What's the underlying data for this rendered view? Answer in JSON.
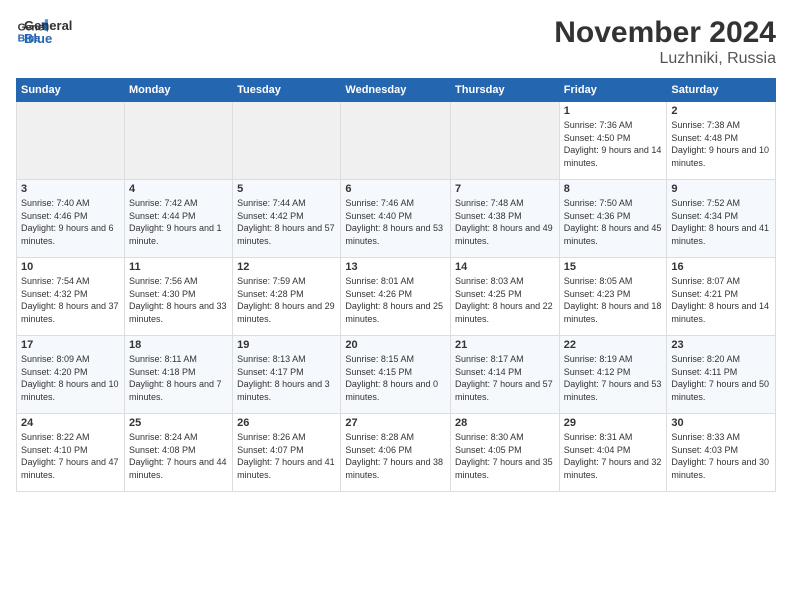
{
  "logo": {
    "line1": "General",
    "line2": "Blue"
  },
  "title": "November 2024",
  "subtitle": "Luzhniki, Russia",
  "days_of_week": [
    "Sunday",
    "Monday",
    "Tuesday",
    "Wednesday",
    "Thursday",
    "Friday",
    "Saturday"
  ],
  "rows": [
    [
      {
        "day": "",
        "info": ""
      },
      {
        "day": "",
        "info": ""
      },
      {
        "day": "",
        "info": ""
      },
      {
        "day": "",
        "info": ""
      },
      {
        "day": "",
        "info": ""
      },
      {
        "day": "1",
        "info": "Sunrise: 7:36 AM\nSunset: 4:50 PM\nDaylight: 9 hours and 14 minutes."
      },
      {
        "day": "2",
        "info": "Sunrise: 7:38 AM\nSunset: 4:48 PM\nDaylight: 9 hours and 10 minutes."
      }
    ],
    [
      {
        "day": "3",
        "info": "Sunrise: 7:40 AM\nSunset: 4:46 PM\nDaylight: 9 hours and 6 minutes."
      },
      {
        "day": "4",
        "info": "Sunrise: 7:42 AM\nSunset: 4:44 PM\nDaylight: 9 hours and 1 minute."
      },
      {
        "day": "5",
        "info": "Sunrise: 7:44 AM\nSunset: 4:42 PM\nDaylight: 8 hours and 57 minutes."
      },
      {
        "day": "6",
        "info": "Sunrise: 7:46 AM\nSunset: 4:40 PM\nDaylight: 8 hours and 53 minutes."
      },
      {
        "day": "7",
        "info": "Sunrise: 7:48 AM\nSunset: 4:38 PM\nDaylight: 8 hours and 49 minutes."
      },
      {
        "day": "8",
        "info": "Sunrise: 7:50 AM\nSunset: 4:36 PM\nDaylight: 8 hours and 45 minutes."
      },
      {
        "day": "9",
        "info": "Sunrise: 7:52 AM\nSunset: 4:34 PM\nDaylight: 8 hours and 41 minutes."
      }
    ],
    [
      {
        "day": "10",
        "info": "Sunrise: 7:54 AM\nSunset: 4:32 PM\nDaylight: 8 hours and 37 minutes."
      },
      {
        "day": "11",
        "info": "Sunrise: 7:56 AM\nSunset: 4:30 PM\nDaylight: 8 hours and 33 minutes."
      },
      {
        "day": "12",
        "info": "Sunrise: 7:59 AM\nSunset: 4:28 PM\nDaylight: 8 hours and 29 minutes."
      },
      {
        "day": "13",
        "info": "Sunrise: 8:01 AM\nSunset: 4:26 PM\nDaylight: 8 hours and 25 minutes."
      },
      {
        "day": "14",
        "info": "Sunrise: 8:03 AM\nSunset: 4:25 PM\nDaylight: 8 hours and 22 minutes."
      },
      {
        "day": "15",
        "info": "Sunrise: 8:05 AM\nSunset: 4:23 PM\nDaylight: 8 hours and 18 minutes."
      },
      {
        "day": "16",
        "info": "Sunrise: 8:07 AM\nSunset: 4:21 PM\nDaylight: 8 hours and 14 minutes."
      }
    ],
    [
      {
        "day": "17",
        "info": "Sunrise: 8:09 AM\nSunset: 4:20 PM\nDaylight: 8 hours and 10 minutes."
      },
      {
        "day": "18",
        "info": "Sunrise: 8:11 AM\nSunset: 4:18 PM\nDaylight: 8 hours and 7 minutes."
      },
      {
        "day": "19",
        "info": "Sunrise: 8:13 AM\nSunset: 4:17 PM\nDaylight: 8 hours and 3 minutes."
      },
      {
        "day": "20",
        "info": "Sunrise: 8:15 AM\nSunset: 4:15 PM\nDaylight: 8 hours and 0 minutes."
      },
      {
        "day": "21",
        "info": "Sunrise: 8:17 AM\nSunset: 4:14 PM\nDaylight: 7 hours and 57 minutes."
      },
      {
        "day": "22",
        "info": "Sunrise: 8:19 AM\nSunset: 4:12 PM\nDaylight: 7 hours and 53 minutes."
      },
      {
        "day": "23",
        "info": "Sunrise: 8:20 AM\nSunset: 4:11 PM\nDaylight: 7 hours and 50 minutes."
      }
    ],
    [
      {
        "day": "24",
        "info": "Sunrise: 8:22 AM\nSunset: 4:10 PM\nDaylight: 7 hours and 47 minutes."
      },
      {
        "day": "25",
        "info": "Sunrise: 8:24 AM\nSunset: 4:08 PM\nDaylight: 7 hours and 44 minutes."
      },
      {
        "day": "26",
        "info": "Sunrise: 8:26 AM\nSunset: 4:07 PM\nDaylight: 7 hours and 41 minutes."
      },
      {
        "day": "27",
        "info": "Sunrise: 8:28 AM\nSunset: 4:06 PM\nDaylight: 7 hours and 38 minutes."
      },
      {
        "day": "28",
        "info": "Sunrise: 8:30 AM\nSunset: 4:05 PM\nDaylight: 7 hours and 35 minutes."
      },
      {
        "day": "29",
        "info": "Sunrise: 8:31 AM\nSunset: 4:04 PM\nDaylight: 7 hours and 32 minutes."
      },
      {
        "day": "30",
        "info": "Sunrise: 8:33 AM\nSunset: 4:03 PM\nDaylight: 7 hours and 30 minutes."
      }
    ]
  ]
}
